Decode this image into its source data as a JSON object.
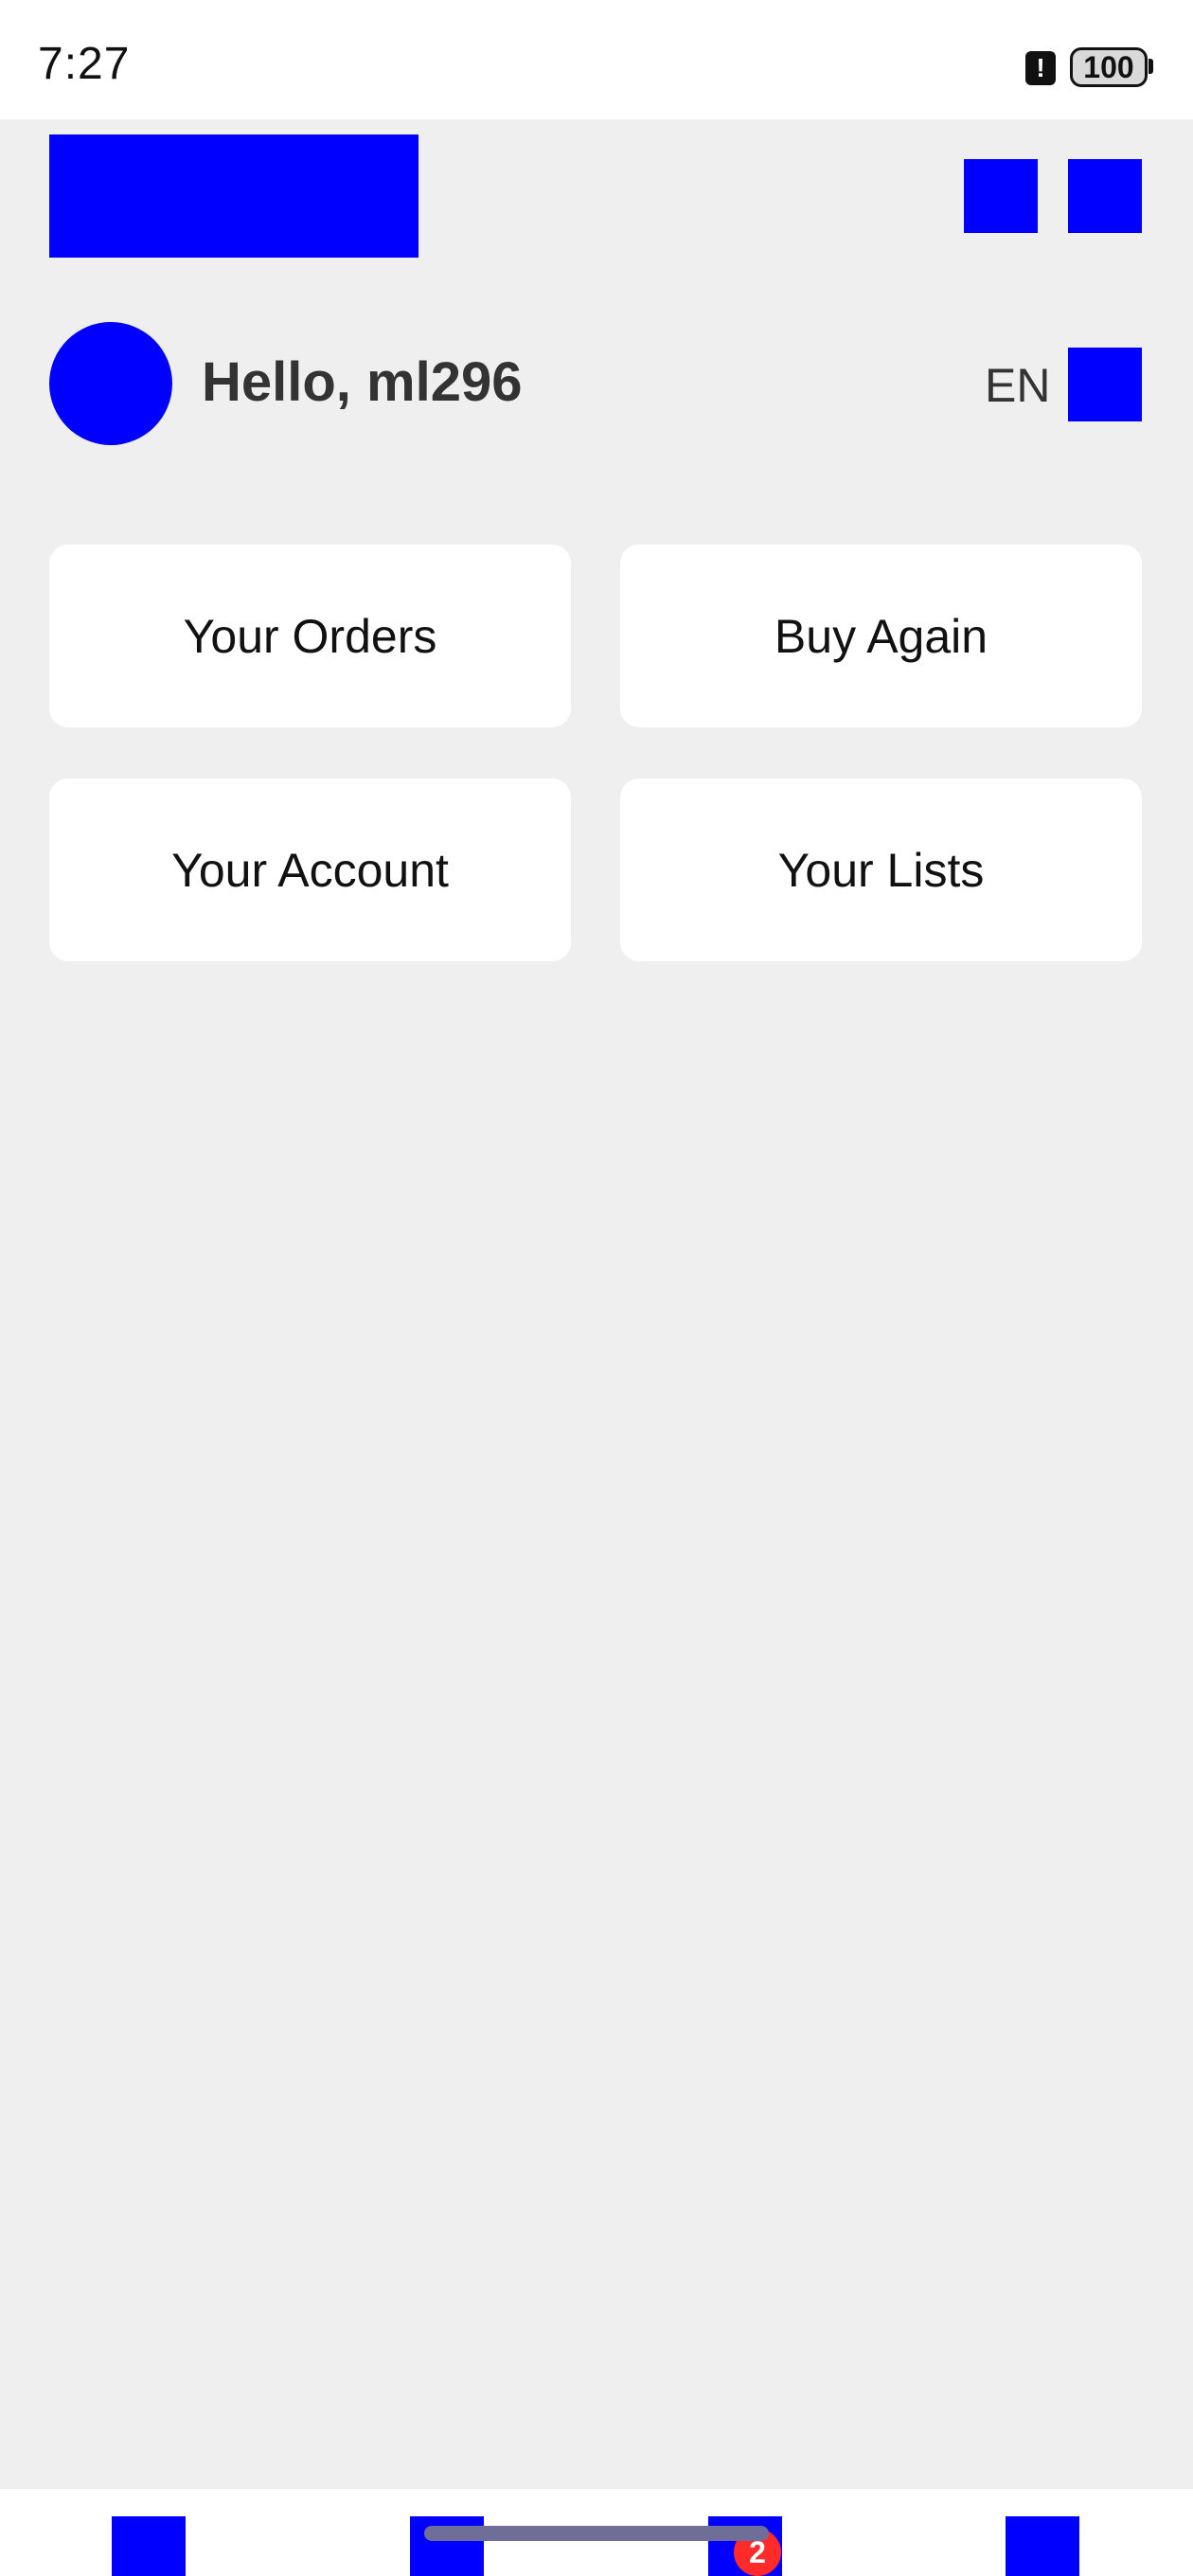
{
  "status_bar": {
    "time": "7:27",
    "alert_glyph": "!",
    "battery": "100"
  },
  "header": {
    "logo_icon": "logo-placeholder",
    "icons": [
      "header-icon-placeholder",
      "header-icon-placeholder"
    ]
  },
  "greeting": {
    "text": "Hello, ml296",
    "language": "EN"
  },
  "tiles": [
    {
      "label": "Your Orders"
    },
    {
      "label": "Buy Again"
    },
    {
      "label": "Your Account"
    },
    {
      "label": "Your Lists"
    }
  ],
  "bottom_nav": {
    "cart_count": "2"
  },
  "colors": {
    "placeholder": "#0000ff",
    "background": "#efeff0",
    "tile": "#ffffff",
    "badge": "#ff2a2a"
  }
}
